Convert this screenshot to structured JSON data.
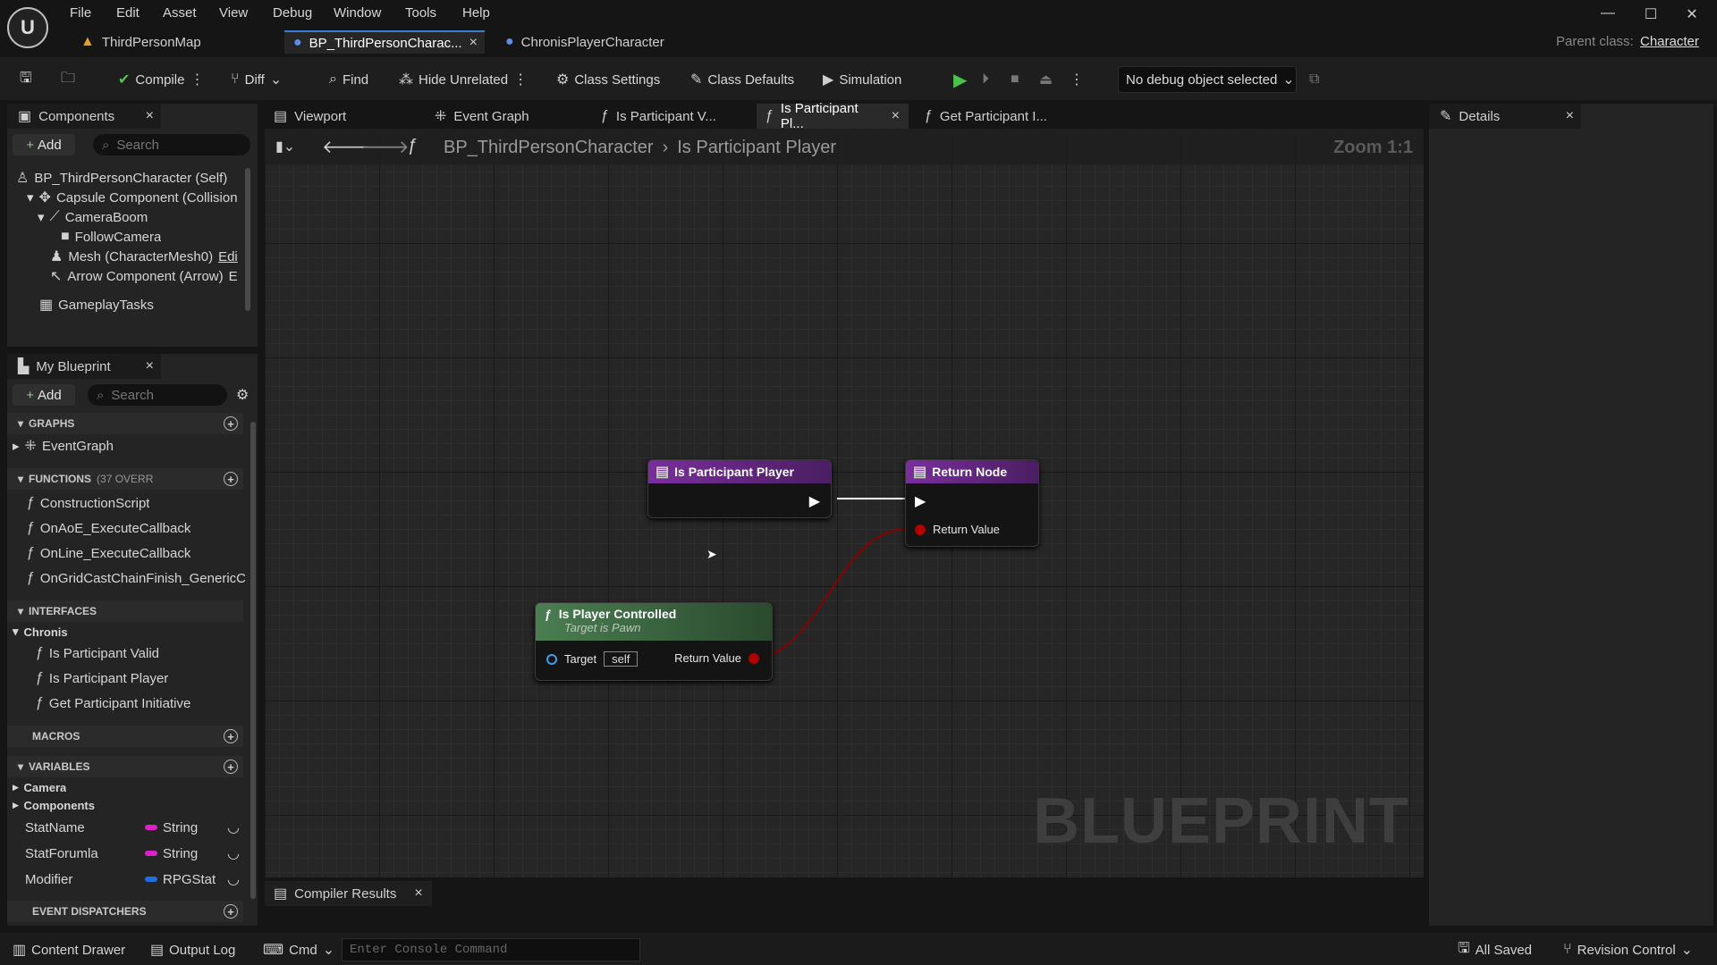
{
  "menu": [
    "File",
    "Edit",
    "Asset",
    "View",
    "Debug",
    "Window",
    "Tools",
    "Help"
  ],
  "doc_tabs": [
    {
      "label": "ThirdPersonMap"
    },
    {
      "label": "BP_ThirdPersonCharac..."
    },
    {
      "label": "ChronisPlayerCharacter"
    }
  ],
  "parent_class": {
    "label": "Parent class:",
    "value": "Character"
  },
  "toolbar": {
    "compile": "Compile",
    "diff": "Diff",
    "find": "Find",
    "hide_unrelated": "Hide Unrelated",
    "class_settings": "Class Settings",
    "class_defaults": "Class Defaults",
    "simulation": "Simulation",
    "debug_object": "No debug object selected"
  },
  "components": {
    "title": "Components",
    "add": "Add",
    "search_placeholder": "Search",
    "items": [
      "BP_ThirdPersonCharacter (Self)",
      "Capsule Component (Collision",
      "CameraBoom",
      "FollowCamera",
      "Mesh (CharacterMesh0)",
      "Arrow Component (Arrow)",
      "GameplayTasks"
    ],
    "edit_hint": "Edi",
    "edit_hint2": "E"
  },
  "my_blueprint": {
    "title": "My Blueprint",
    "add": "Add",
    "search_placeholder": "Search",
    "graphs_label": "GRAPHS",
    "graphs": [
      "EventGraph"
    ],
    "functions_label": "FUNCTIONS",
    "functions_count": "(37 OVERR",
    "functions": [
      "ConstructionScript",
      "OnAoE_ExecuteCallback",
      "OnLine_ExecuteCallback",
      "OnGridCastChainFinish_GenericC"
    ],
    "interfaces_label": "INTERFACES",
    "interface_group": "Chronis",
    "interfaces": [
      "Is Participant Valid",
      "Is Participant Player",
      "Get Participant Initiative"
    ],
    "macros_label": "MACROS",
    "variables_label": "VARIABLES",
    "var_groups": [
      "Camera",
      "Components"
    ],
    "variables": [
      {
        "name": "StatName",
        "type": "String",
        "color": "#e020c8"
      },
      {
        "name": "StatForumla",
        "type": "String",
        "color": "#e020c8"
      },
      {
        "name": "Modifier",
        "type": "RPGStat",
        "color": "#1f6fe0"
      }
    ],
    "dispatchers_label": "EVENT DISPATCHERS"
  },
  "graph_tabs": [
    "Viewport",
    "Event Graph",
    "Is Participant V...",
    "Is Participant Pl...",
    "Get Participant I..."
  ],
  "breadcrumb": {
    "root": "BP_ThirdPersonCharacter",
    "current": "Is Participant Player"
  },
  "zoom": "Zoom 1:1",
  "nodes": {
    "entry": {
      "title": "Is Participant Player"
    },
    "return": {
      "title": "Return Node",
      "pin": "Return Value"
    },
    "call": {
      "title": "Is Player Controlled",
      "subtitle": "Target is Pawn",
      "target": "Target",
      "target_value": "self",
      "output": "Return Value"
    }
  },
  "watermark": "BLUEPRINT",
  "compiler_tab": "Compiler Results",
  "details": {
    "title": "Details"
  },
  "statusbar": {
    "content_drawer": "Content Drawer",
    "output_log": "Output Log",
    "cmd": "Cmd",
    "console_placeholder": "Enter Console Command",
    "all_saved": "All Saved",
    "revision_control": "Revision Control"
  },
  "colors": {
    "accent": "#3a7bd5",
    "function_header": "#6c2a8f",
    "pure_header": "#3f6e45",
    "exec": "#ffffff",
    "bool_pin": "#b00000"
  }
}
